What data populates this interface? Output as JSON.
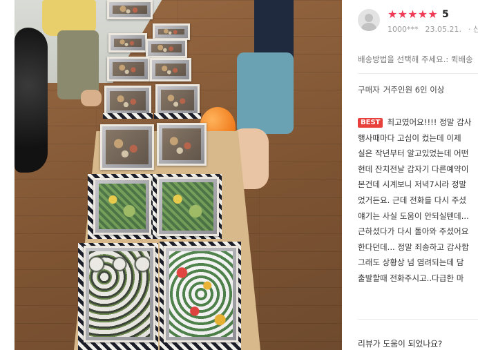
{
  "review": {
    "rating_stars": 5,
    "rating_value": "5",
    "reviewer_id": "1000***",
    "date": "23.05.21.",
    "date_suffix": "·  신",
    "option_text": "배송방법을 선택해 주세요.: 퀵배송",
    "buyer_label": "구매자",
    "buyer_value": "거주인원 6인 이상",
    "best_badge": "BEST",
    "body_lines": [
      "최고였어요!!!! 정말 감사",
      "행사때마다 고심이 컸는데 이제",
      "실은 작년부터 알고있었는데 어떤",
      "현데 잔치전날 갑자기 다른예약이",
      "본건데 시계보니 저녁7시라 정말",
      "었거든요. 근데 전화를 다시 주셨",
      "얘기는 사실 도움이 안되실텐데...",
      "근하셨다가 다시 돌아와 주셨어요",
      "한다던데... 정말 죄송하고 감사합",
      "그래도 상황상 넘 염려되는데 담",
      "출발할때 전화주시고..다급한 마"
    ],
    "helpful_question": "리뷰가 도움이 되었나요?"
  },
  "photo": {
    "subject": "food trays on wooden board"
  },
  "colors": {
    "star": "#ef3b55",
    "best_badge": "#e8413b"
  }
}
